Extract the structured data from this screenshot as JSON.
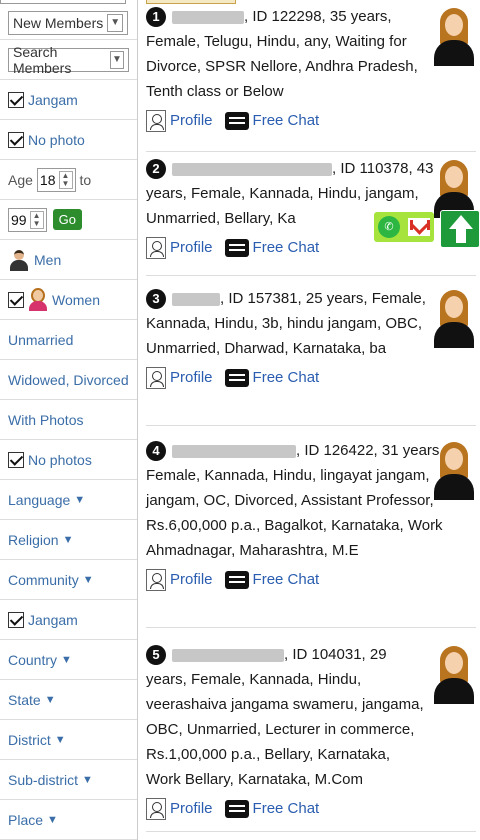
{
  "sidebar": {
    "members_select": "New Members",
    "search_select": "Search Members",
    "jangam_top": "Jangam",
    "no_photo": "No photo",
    "age_label": "Age",
    "age_from": "18",
    "to_label": "to",
    "age_to": "99",
    "go_label": "Go",
    "men_label": "Men",
    "women_label": "Women",
    "unmarried": "Unmarried",
    "widowed": "Widowed, Divorced",
    "with_photos": "With Photos",
    "no_photos": "No photos",
    "language": "Language",
    "religion": "Religion",
    "community": "Community",
    "jangam_bottom": "Jangam",
    "country": "Country",
    "state": "State",
    "district": "District",
    "subdistrict": "Sub-district",
    "place": "Place",
    "dropdown_marker": "▼"
  },
  "profiles": [
    {
      "num": "1",
      "text": ", ID 122298, 35 years, Female, Telugu, Hindu, any, Waiting for Divorce, SPSR Nellore, Andhra Pradesh, Tenth class or Below"
    },
    {
      "num": "2",
      "text": ", ID 110378, 43 years, Female, Kannada, Hindu, jangam, Unmarried, Bellary, Ka"
    },
    {
      "num": "3",
      "text": ", ID 157381, 25 years, Female, Kannada, Hindu, 3b, hindu jangam, OBC, Unmarried, Dharwad, Karnataka, ba"
    },
    {
      "num": "4",
      "text": ", ID 126422, 31 years, Female, Kannada, Hindu, lingayat jangam, jangam, OC, Divorced, Assistant Professor, Rs.6,00,000 p.a., Bagalkot, Karnataka, Work Ahmadnagar, Maharashtra, M.E"
    },
    {
      "num": "5",
      "text": ", ID 104031, 29 years, Female, Kannada, Hindu, veerashaiva jangama swameru, jangama, OBC, Unmarried, Lecturer in commerce, Rs.1,00,000 p.a., Bellary, Karnataka, Work Bellary, Karnataka, M.Com"
    }
  ],
  "links": {
    "profile": "Profile",
    "chat": "Free Chat"
  }
}
